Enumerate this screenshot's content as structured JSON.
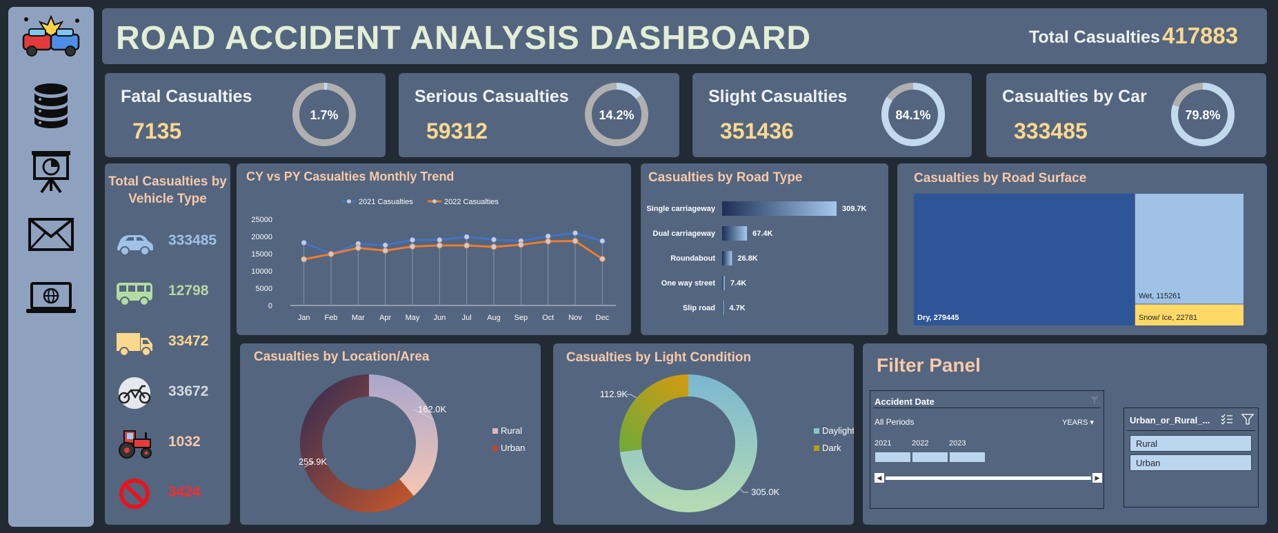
{
  "header": {
    "title": "ROAD ACCIDENT ANALYSIS DASHBOARD",
    "total_label": "Total Casualties",
    "total_value": "417883"
  },
  "kpis": [
    {
      "label": "Fatal Casualties",
      "value": "7135",
      "pct": "1.7%",
      "fraction": 0.017,
      "ring_color": "#c3d9ee",
      "track_color": "#b0b0b0"
    },
    {
      "label": "Serious Casualties",
      "value": "59312",
      "pct": "14.2%",
      "fraction": 0.142,
      "ring_color": "#c3d9ee",
      "track_color": "#b0b0b0"
    },
    {
      "label": "Slight Casualties",
      "value": "351436",
      "pct": "84.1%",
      "fraction": 0.841,
      "ring_color": "#c3d9ee",
      "track_color": "#b0b0b0"
    },
    {
      "label": "Casualties by Car",
      "value": "333485",
      "pct": "79.8%",
      "fraction": 0.798,
      "ring_color": "#c3d9ee",
      "track_color": "#b0b0b0"
    }
  ],
  "vehicle": {
    "title": "Total Casualties by Vehicle Type",
    "items": [
      {
        "icon": "car-icon",
        "value": "333485",
        "color": "#9fc2e6"
      },
      {
        "icon": "bus-icon",
        "value": "12798",
        "color": "#b4dba1"
      },
      {
        "icon": "truck-icon",
        "value": "33472",
        "color": "#fbd88e"
      },
      {
        "icon": "motorcycle-icon",
        "value": "33672",
        "color": "#d5d9de"
      },
      {
        "icon": "tractor-icon",
        "value": "1032",
        "color": "#f8c9a8"
      },
      {
        "icon": "no-entry-icon",
        "value": "3424",
        "color": "#ff2a2a"
      }
    ]
  },
  "trend": {
    "title": "CY vs PY Casualties Monthly Trend"
  },
  "road_type": {
    "title": "Casualties by Road Type"
  },
  "road_surface": {
    "title": "Casualties by Road Surface"
  },
  "location": {
    "title": "Casualties by Location/Area"
  },
  "light": {
    "title": "Casualties by Light Condition"
  },
  "filter": {
    "title": "Filter Panel",
    "date_slicer": {
      "header": "Accident Date",
      "period": "All Periods",
      "unit": "YEARS",
      "years": [
        "2021",
        "2022",
        "2023"
      ]
    },
    "area_slicer": {
      "header": "Urban_or_Rural_...",
      "options": [
        "Rural",
        "Urban"
      ]
    }
  },
  "chart_data": [
    {
      "type": "line",
      "title": "CY vs PY Casualties Monthly Trend",
      "categories": [
        "Jan",
        "Feb",
        "Mar",
        "Apr",
        "May",
        "Jun",
        "Jul",
        "Aug",
        "Sep",
        "Oct",
        "Nov",
        "Dec"
      ],
      "series": [
        {
          "name": "2021 Casualties",
          "color": "#4472c4",
          "values": [
            18200,
            15000,
            17900,
            17500,
            19000,
            19000,
            19900,
            19100,
            18700,
            20100,
            21000,
            18700
          ]
        },
        {
          "name": "2022 Casualties",
          "color": "#ed7d31",
          "values": [
            13400,
            14900,
            16700,
            15900,
            17100,
            17400,
            17400,
            17000,
            17600,
            18600,
            18700,
            13500
          ]
        }
      ],
      "ylim": [
        0,
        25000
      ],
      "yticks": [
        "0",
        "5000",
        "10000",
        "15000",
        "20000",
        "25000"
      ],
      "legend": "top"
    },
    {
      "type": "bar",
      "orientation": "horizontal",
      "title": "Casualties by Road Type",
      "categories": [
        "Single carriageway",
        "Dual carriageway",
        "Roundabout",
        "One way street",
        "Slip road"
      ],
      "values": [
        309700,
        67400,
        26800,
        7400,
        4700
      ],
      "labels": [
        "309.7K",
        "67.4K",
        "26.8K",
        "7.4K",
        "4.7K"
      ]
    },
    {
      "type": "treemap",
      "title": "Casualties by Road Surface",
      "items": [
        {
          "label": "Dry, 279445",
          "value": 279445,
          "color": "#2e5597"
        },
        {
          "label": "Wet, 115261",
          "value": 115261,
          "color": "#9fc2e6"
        },
        {
          "label": "Snow/ Ice, 22781",
          "value": 22781,
          "color": "#ffd966"
        }
      ]
    },
    {
      "type": "pie",
      "title": "Casualties by Location/Area",
      "donut": true,
      "slices": [
        {
          "name": "Rural",
          "value": 162000,
          "label": "162.0K",
          "color": "#d7b8c8"
        },
        {
          "name": "Urban",
          "value": 255900,
          "label": "255.9K",
          "color": "#b4492e"
        }
      ],
      "legend": "right"
    },
    {
      "type": "pie",
      "title": "Casualties by Light Condition",
      "donut": true,
      "slices": [
        {
          "name": "Daylight",
          "value": 305000,
          "label": "305.0K",
          "color": "#8ec3c9"
        },
        {
          "name": "Dark",
          "value": 112900,
          "label": "112.9K",
          "color": "#b89e12"
        }
      ],
      "legend": "right"
    }
  ]
}
